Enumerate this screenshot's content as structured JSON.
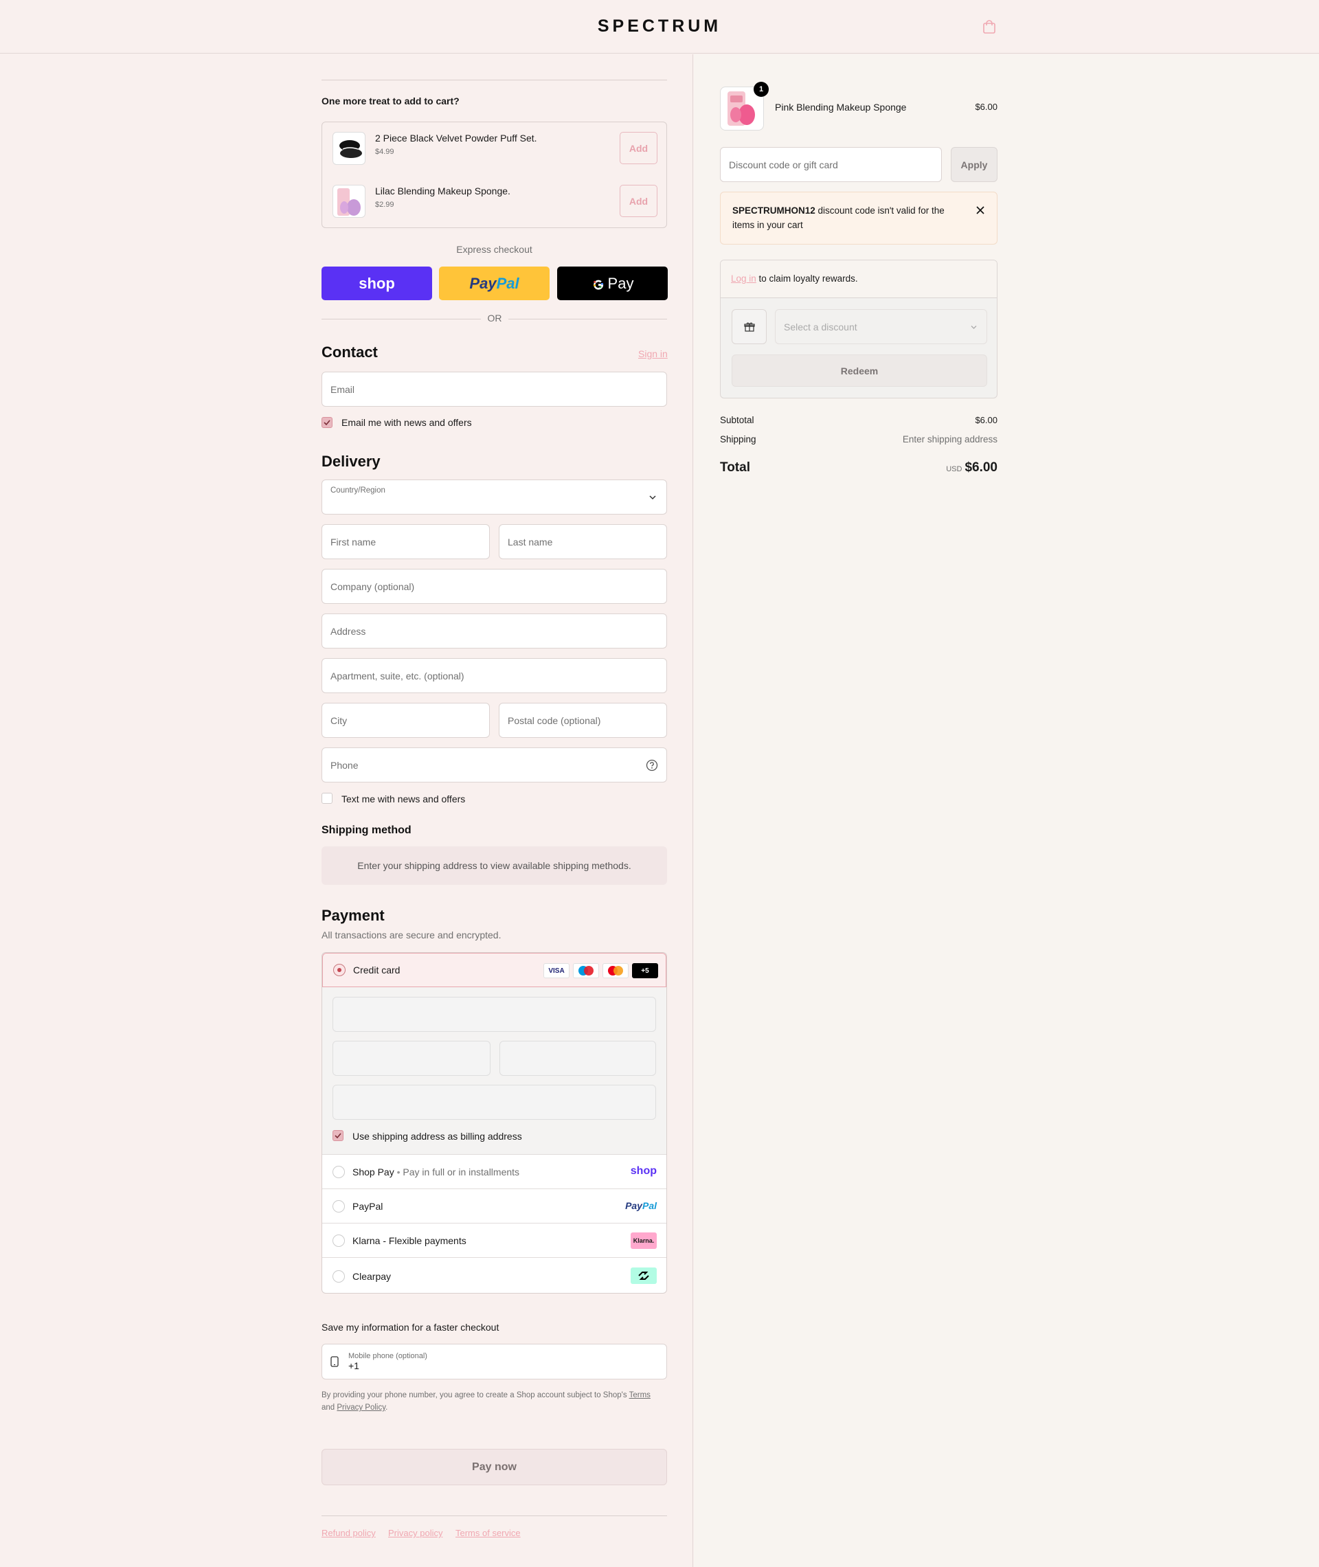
{
  "header": {
    "logo": "SPECTRUM",
    "cart_icon": "shopping-bag-icon"
  },
  "upsell": {
    "title": "One more treat to add to cart?",
    "items": [
      {
        "name": "2 Piece Black Velvet Powder Puff Set.",
        "price": "$4.99",
        "add_label": "Add"
      },
      {
        "name": "Lilac Blending Makeup Sponge.",
        "price": "$2.99",
        "add_label": "Add"
      }
    ]
  },
  "express": {
    "label": "Express checkout",
    "shop_label": "shop",
    "paypal_label_1": "Pay",
    "paypal_label_2": "Pal",
    "gpay_label": "Pay",
    "or_label": "OR"
  },
  "contact": {
    "title": "Contact",
    "sign_in": "Sign in",
    "email_placeholder": "Email",
    "news_label": "Email me with news and offers"
  },
  "delivery": {
    "title": "Delivery",
    "country_label": "Country/Region",
    "first_name": "First name",
    "last_name": "Last name",
    "company": "Company (optional)",
    "address": "Address",
    "apartment": "Apartment, suite, etc. (optional)",
    "city": "City",
    "postal": "Postal code (optional)",
    "phone": "Phone",
    "text_label": "Text me with news and offers"
  },
  "shipping": {
    "title": "Shipping method",
    "notice": "Enter your shipping address to view available shipping methods."
  },
  "payment": {
    "title": "Payment",
    "subtitle": "All transactions are secure and encrypted.",
    "credit_card": "Credit card",
    "card_more": "+5",
    "visa": "VISA",
    "billing_label": "Use shipping address as billing address",
    "shop_pay": "Shop Pay",
    "shop_pay_sub": "Pay in full or in installments",
    "shop_pay_logo": "shop",
    "paypal": "PayPal",
    "paypal_logo_1": "Pay",
    "paypal_logo_2": "Pal",
    "klarna": "Klarna - Flexible payments",
    "klarna_logo": "Klarna.",
    "clearpay": "Clearpay"
  },
  "save_info": {
    "title": "Save my information for a faster checkout",
    "phone_label": "Mobile phone (optional)",
    "phone_value": "+1",
    "legal_1": "By providing your phone number, you agree to create a Shop account subject to Shop's",
    "terms": "Terms",
    "legal_and": "and",
    "privacy": "Privacy Policy",
    "legal_end": "."
  },
  "pay_now": "Pay now",
  "footer": {
    "refund": "Refund policy",
    "privacy": "Privacy policy",
    "terms": "Terms of service"
  },
  "summary": {
    "product_name": "Pink Blending Makeup Sponge",
    "product_price": "$6.00",
    "quantity": "1",
    "discount_placeholder": "Discount code or gift card",
    "apply": "Apply",
    "alert_code": "SPECTRUMHON12",
    "alert_text": " discount code isn't valid for the items in your cart",
    "login_link": "Log in",
    "login_text": " to claim loyalty rewards.",
    "select_discount": "Select a discount",
    "redeem": "Redeem",
    "subtotal_label": "Subtotal",
    "subtotal_value": "$6.00",
    "shipping_label": "Shipping",
    "shipping_value": "Enter shipping address",
    "total_label": "Total",
    "currency": "USD",
    "total_value": "$6.00"
  },
  "colors": {
    "accent": "#f0a7b1",
    "shop_purple": "#5a31f4",
    "paypal_yellow": "#ffc439",
    "page_bg": "#f9f0ee"
  }
}
